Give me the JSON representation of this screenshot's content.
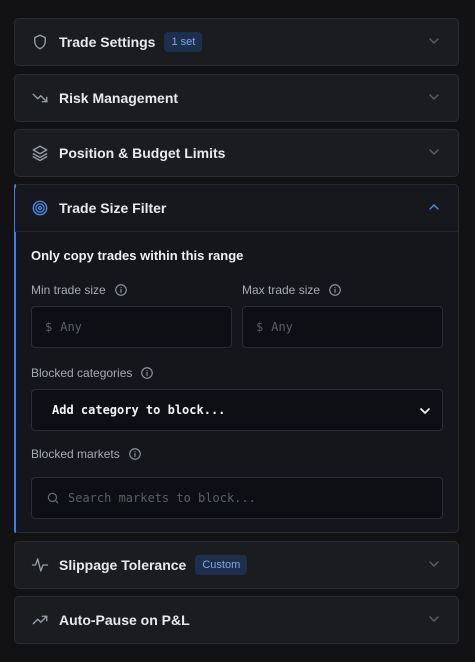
{
  "sections": {
    "trade_settings": {
      "title": "Trade Settings",
      "badge": "1 set"
    },
    "risk_management": {
      "title": "Risk Management"
    },
    "position_budget": {
      "title": "Position & Budget Limits"
    },
    "trade_size_filter": {
      "title": "Trade Size Filter",
      "subtitle": "Only copy trades within this range",
      "min_label": "Min trade size",
      "max_label": "Max trade size",
      "currency_symbol": "$",
      "min_placeholder": "Any",
      "max_placeholder": "Any",
      "blocked_categories_label": "Blocked categories",
      "category_select_value": "Add category to block...",
      "blocked_markets_label": "Blocked markets",
      "markets_search_placeholder": "Search markets to block..."
    },
    "slippage": {
      "title": "Slippage Tolerance",
      "badge": "Custom"
    },
    "auto_pause": {
      "title": "Auto-Pause on P&L"
    }
  },
  "icons": {
    "trade_settings": "shield-icon",
    "risk_management": "trending-down-icon",
    "position_budget": "layers-icon",
    "trade_size_filter": "target-icon",
    "slippage": "activity-icon",
    "auto_pause": "trending-up-icon"
  },
  "colors": {
    "accent": "#3e7fe3",
    "badge_bg": "#1d2f4d",
    "badge_text": "#7fa7e6"
  }
}
